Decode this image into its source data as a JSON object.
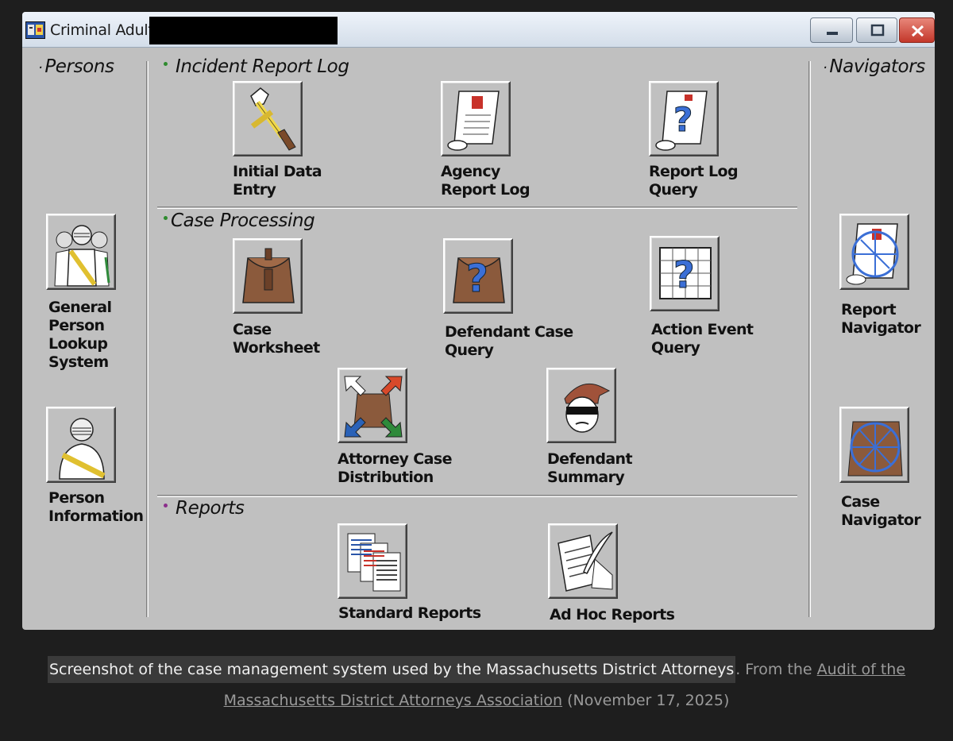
{
  "window": {
    "title": "Criminal Adult"
  },
  "sections": {
    "persons": "Persons",
    "incident_report_log": "Incident Report Log",
    "case_processing": "Case Processing",
    "reports": "Reports",
    "navigators": "Navigators"
  },
  "buttons": {
    "initial_data_entry": "Initial Data\nEntry",
    "agency_report_log": "Agency\nReport Log",
    "report_log_query": "Report Log\nQuery",
    "case_worksheet": "Case\nWorksheet",
    "defendant_case_query": "Defendant Case\nQuery",
    "action_event_query": "Action Event\nQuery",
    "attorney_case_distribution": "Attorney Case\nDistribution",
    "defendant_summary": "Defendant\nSummary",
    "standard_reports": "Standard Reports",
    "ad_hoc_reports": "Ad Hoc Reports",
    "general_person_lookup": "General\nPerson\nLookup\nSystem",
    "person_information": "Person\nInformation",
    "report_navigator": "Report\nNavigator",
    "case_navigator": "Case\nNavigator"
  },
  "caption": {
    "main": "Screenshot of the case management system used by the Massachusetts District Attorneys",
    "from": ". From the ",
    "link1": "Audit of the",
    "link2": "Massachusetts District Attorneys Association",
    "date": " (November 17, 2025)"
  },
  "colors": {
    "window_bg": "#c0c0c0",
    "bullet_incident": "#2e8b2e",
    "bullet_case": "#2e8b2e",
    "bullet_reports": "#8b2e8b",
    "bag_brown": "#8b5a3c",
    "query_blue": "#3b6fd6"
  }
}
